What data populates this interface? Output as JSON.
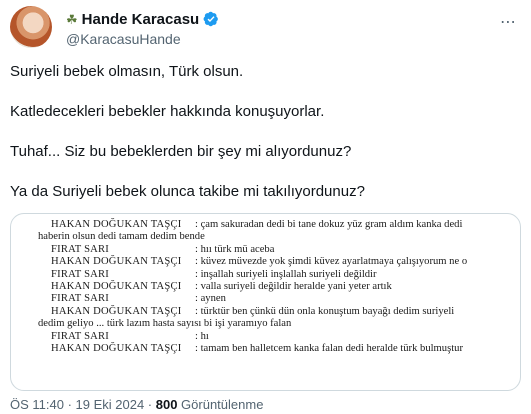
{
  "author": {
    "name": "Hande Karacasu",
    "handle": "@KaracasuHande",
    "name_emoji": "☘",
    "verified_color": "#1d9bf0"
  },
  "tweet": {
    "paragraphs": [
      "Suriyeli bebek olmasın, Türk olsun.",
      "Katledecekleri bebekler hakkında konuşuyorlar.",
      "Tuhaf... Siz bu bebeklerden bir şey mi alıyordunuz?",
      "Ya da Suriyeli bebek olunca takibe mi takılıyordunuz?"
    ]
  },
  "image": {
    "lines": [
      {
        "speaker": "HAKAN DOĞUKAN TAŞÇI",
        "text": ": çam sakuradan dedi bi tane dokuz yüz gram aldım kanka dedi",
        "cont": "haberin olsun dedi tamam dedim bende"
      },
      {
        "speaker": "FIRAT SARI",
        "text": ": hıı türk mü aceba",
        "cont": ""
      },
      {
        "speaker": "HAKAN DOĞUKAN TAŞÇI",
        "text": ": küvez müvezde yok şimdi küvez ayarlatmaya çalışıyorum ne o",
        "cont": ""
      },
      {
        "speaker": "FIRAT SARI",
        "text": ": inşallah suriyeli inşlallah suriyeli değildir",
        "cont": ""
      },
      {
        "speaker": "HAKAN DOĞUKAN TAŞÇI",
        "text": ": valla suriyeli değildir heralde yani yeter artık",
        "cont": ""
      },
      {
        "speaker": "FIRAT SARI",
        "text": ": aynen",
        "cont": ""
      },
      {
        "speaker": "HAKAN DOĞUKAN TAŞÇI",
        "text": ": türktür ben çünkü dün onla konuştum bayağı dedim suriyeli",
        "cont": "dedim geliyo ... türk lazım hasta sayısı bi işi yaramıyo falan"
      },
      {
        "speaker": "FIRAT SARI",
        "text": ": hı",
        "cont": ""
      },
      {
        "speaker": "HAKAN DOĞUKAN TAŞÇI",
        "text": ": tamam ben halletcem kanka falan dedi heralde türk bulmuştur",
        "cont": ""
      }
    ]
  },
  "meta": {
    "time_date": "ÖS 11:40 · 19 Eki 2024 · ",
    "views_count": "800",
    "views_label": " Görüntülenme"
  }
}
